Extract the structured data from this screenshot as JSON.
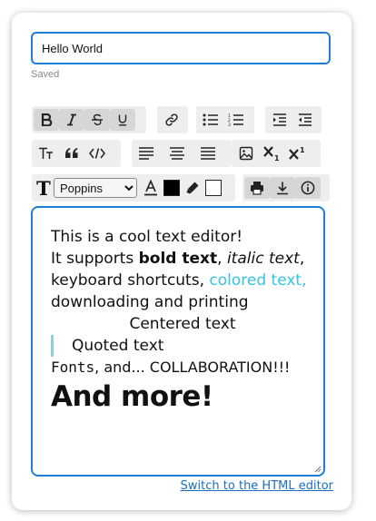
{
  "editor_title": {
    "value": "Hello World",
    "status": "Saved"
  },
  "toolbar": {
    "font_options": [
      "Poppins"
    ],
    "font_selected": "Poppins",
    "text_color": "#000000",
    "highlight_color": "#ffffff",
    "big_t_glyph": "T"
  },
  "content": {
    "line1": "This is a cool text editor!",
    "line2_prefix": "It supports ",
    "line2_bold": "bold text",
    "line2_sep": ", ",
    "line2_italic": "italic text",
    "line2_end": ",",
    "line3_prefix": "keyboard shortcuts, ",
    "line3_colored": "colored text,",
    "line4": "downloading and printing",
    "centered": "Centered text",
    "quote": "Quoted text",
    "fonts_word": "Fonts",
    "fonts_rest": ", and... COLLABORATION!!!",
    "more": "And more!"
  },
  "colors": {
    "accent": "#1b7fd6",
    "colored_text": "#33c5e0",
    "quote_bar": "#8fd0de"
  },
  "footer": {
    "switch_link": "Switch to the HTML editor"
  }
}
